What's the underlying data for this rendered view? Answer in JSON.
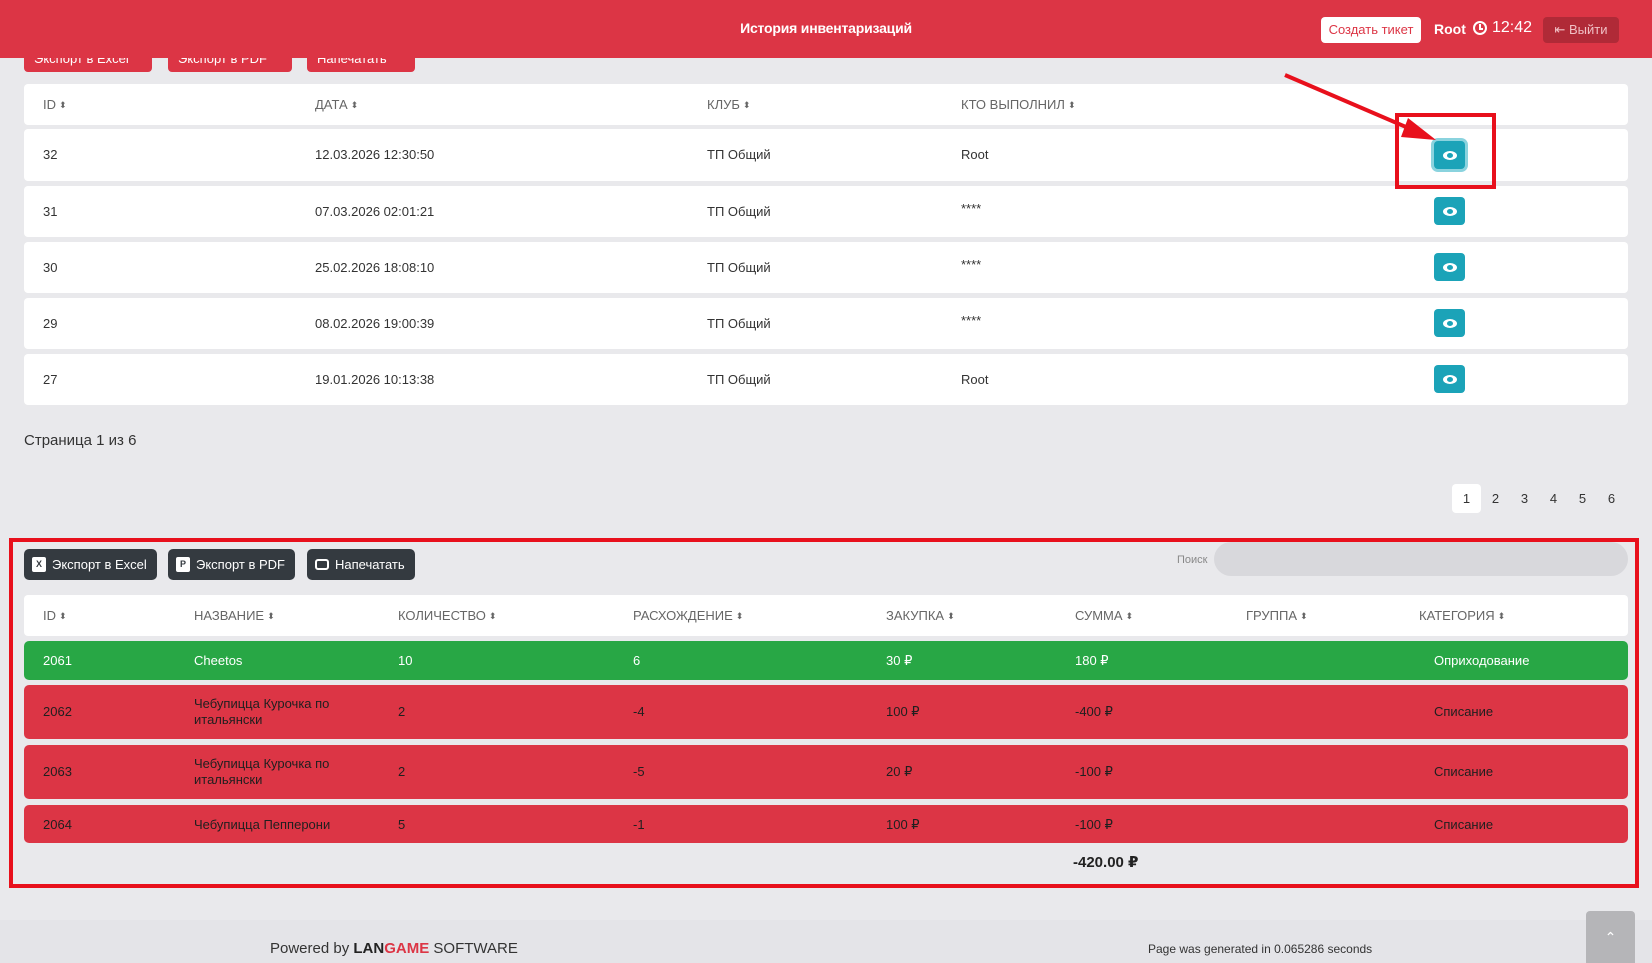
{
  "header": {
    "title": "История инвентаризаций",
    "create_ticket": "Создать тикет",
    "user": "Root",
    "time": "12:42",
    "logout": "Выйти"
  },
  "top_buttons": {
    "excel": "Экспорт в Excel",
    "pdf": "Экспорт в PDF",
    "print": "Напечатать"
  },
  "inventory_table": {
    "headers": [
      "ID",
      "ДАТА",
      "КЛУБ",
      "КТО ВЫПОЛНИЛ"
    ],
    "rows": [
      {
        "id": "32",
        "date": "12.03.2026 12:30:50",
        "club": "ТП Общий",
        "by": "Root"
      },
      {
        "id": "31",
        "date": "07.03.2026 02:01:21",
        "club": "ТП Общий",
        "by": "****"
      },
      {
        "id": "30",
        "date": "25.02.2026 18:08:10",
        "club": "ТП Общий",
        "by": "****"
      },
      {
        "id": "29",
        "date": "08.02.2026 19:00:39",
        "club": "ТП Общий",
        "by": "****"
      },
      {
        "id": "27",
        "date": "19.01.2026 10:13:38",
        "club": "ТП Общий",
        "by": "Root"
      }
    ]
  },
  "pagination": {
    "info": "Страница 1 из 6",
    "pages": [
      "1",
      "2",
      "3",
      "4",
      "5",
      "6"
    ],
    "current": "1"
  },
  "detail": {
    "buttons": {
      "excel": "Экспорт в Excel",
      "pdf": "Экспорт в PDF",
      "print": "Напечатать"
    },
    "search_label": "Поиск",
    "headers": [
      "ID",
      "НАЗВАНИЕ",
      "КОЛИЧЕСТВО",
      "РАСХОЖДЕНИЕ",
      "ЗАКУПКА",
      "СУММА",
      "ГРУППА",
      "КАТЕГОРИЯ"
    ],
    "rows": [
      {
        "id": "2061",
        "name": "Cheetos",
        "name2": "",
        "qty": "10",
        "diff": "6",
        "buy": "30 ₽",
        "sum": "180 ₽",
        "group": "",
        "category": "Оприходование",
        "status": "green"
      },
      {
        "id": "2062",
        "name": "Чебупицца Курочка по",
        "name2": "итальянски",
        "qty": "2",
        "diff": "-4",
        "buy": "100 ₽",
        "sum": "-400 ₽",
        "group": "",
        "category": "Списание",
        "status": "red"
      },
      {
        "id": "2063",
        "name": "Чебупицца Курочка по",
        "name2": "итальянски",
        "qty": "2",
        "diff": "-5",
        "buy": "20 ₽",
        "sum": "-100 ₽",
        "group": "",
        "category": "Списание",
        "status": "red"
      },
      {
        "id": "2064",
        "name": "Чебупицца Пепперони",
        "name2": "",
        "qty": "5",
        "diff": "-1",
        "buy": "100 ₽",
        "sum": "-100 ₽",
        "group": "",
        "category": "Списание",
        "status": "red"
      }
    ],
    "total": "-420.00 ₽"
  },
  "footer": {
    "powered_prefix": "Powered by",
    "brand_lan": "LAN",
    "brand_game": "GAME",
    "brand_suffix": "SOFTWARE",
    "generated": "Page was generated in 0.065286 seconds"
  },
  "colors": {
    "header_red": "#dc3545",
    "eye_button": "#1ba3b8",
    "row_green": "#28a745",
    "row_red": "#dc3545",
    "annotation_red": "#e8101c"
  }
}
